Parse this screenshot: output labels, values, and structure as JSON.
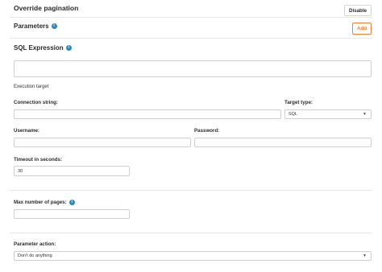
{
  "header": {
    "title": "Override pagination",
    "disable_label": "Disable"
  },
  "parameters": {
    "title": "Parameters",
    "add_label": "Add",
    "info_glyph": "i"
  },
  "sql": {
    "title": "SQL Expression",
    "value": "",
    "info_glyph": "i"
  },
  "execution": {
    "title": "Execution target",
    "connection_label": "Connection string:",
    "connection_value": "",
    "target_type_label": "Target type:",
    "target_type_value": "SQL",
    "username_label": "Username:",
    "username_value": "",
    "password_label": "Password:",
    "password_value": ""
  },
  "timeout": {
    "label": "Timeout in seconds:",
    "value": "30"
  },
  "max_pages": {
    "label": "Max number of pages:",
    "value": "",
    "info_glyph": "i"
  },
  "param_action": {
    "label": "Parameter action:",
    "value": "Don't do anything"
  },
  "colors": {
    "accent": "#e8833a",
    "info": "#2f86b8",
    "border": "#cfcfcf"
  }
}
